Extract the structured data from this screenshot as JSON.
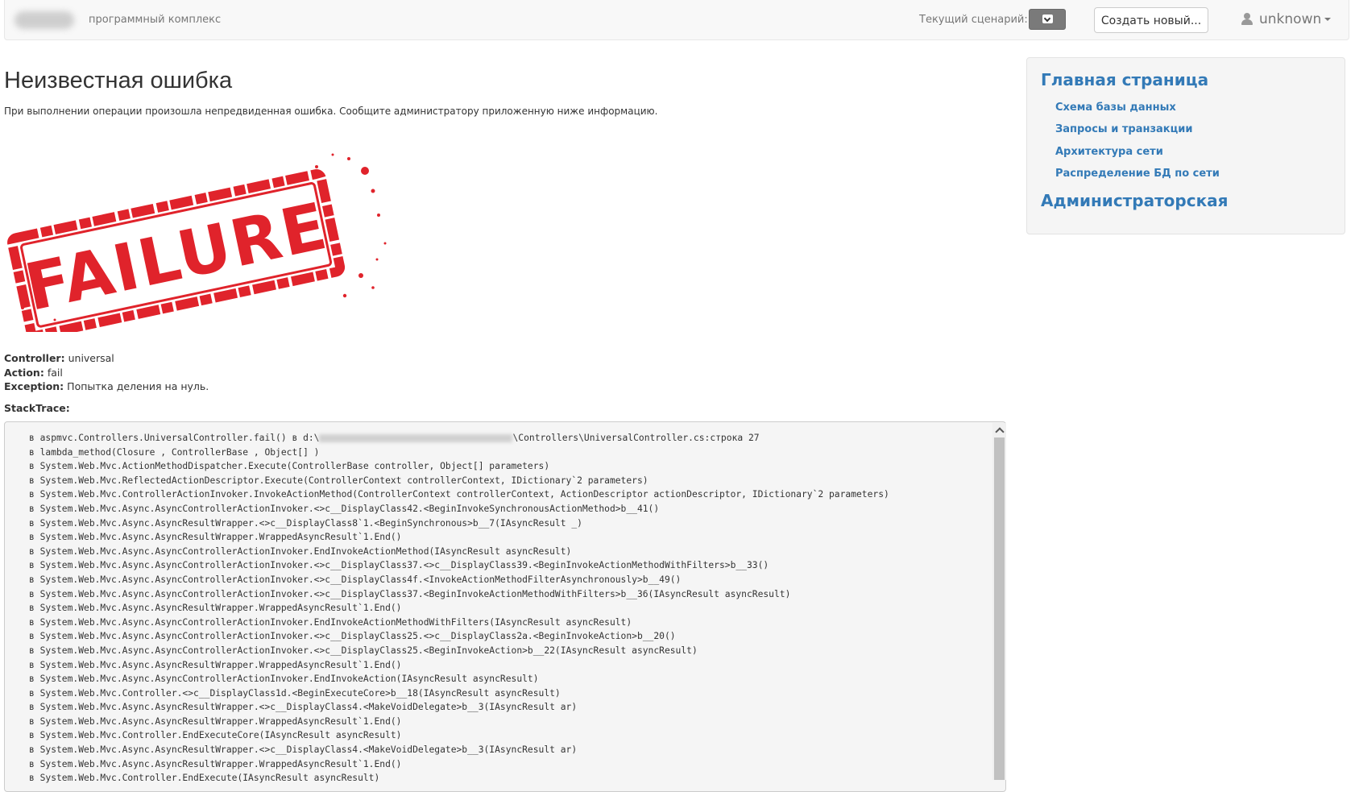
{
  "navbar": {
    "brand_text": "программный комплекс",
    "scenario_label": "Текущий сценарий:",
    "create_button": "Создать новый...",
    "user_name": "unknown"
  },
  "main": {
    "title": "Неизвестная ошибка",
    "subtitle": "При выполнении операции произошла непредвиденная ошибка. Сообщите администратору приложенную ниже информацию.",
    "image_text": "FAILURE",
    "controller_label": "Controller:",
    "controller_value": "universal",
    "action_label": "Action:",
    "action_value": "fail",
    "exception_label": "Exception:",
    "exception_value": "Попытка деления на нуль.",
    "stacktrace_label": "StackTrace:",
    "stack_first_prefix": "в aspmvc.Controllers.UniversalController.fail() в d:\\",
    "stack_first_suffix": "\\Controllers\\UniversalController.cs:строка 27",
    "stack_lines": [
      "в lambda_method(Closure , ControllerBase , Object[] )",
      "в System.Web.Mvc.ActionMethodDispatcher.Execute(ControllerBase controller, Object[] parameters)",
      "в System.Web.Mvc.ReflectedActionDescriptor.Execute(ControllerContext controllerContext, IDictionary`2 parameters)",
      "в System.Web.Mvc.ControllerActionInvoker.InvokeActionMethod(ControllerContext controllerContext, ActionDescriptor actionDescriptor, IDictionary`2 parameters)",
      "в System.Web.Mvc.Async.AsyncControllerActionInvoker.<>c__DisplayClass42.<BeginInvokeSynchronousActionMethod>b__41()",
      "в System.Web.Mvc.Async.AsyncResultWrapper.<>c__DisplayClass8`1.<BeginSynchronous>b__7(IAsyncResult _)",
      "в System.Web.Mvc.Async.AsyncResultWrapper.WrappedAsyncResult`1.End()",
      "в System.Web.Mvc.Async.AsyncControllerActionInvoker.EndInvokeActionMethod(IAsyncResult asyncResult)",
      "в System.Web.Mvc.Async.AsyncControllerActionInvoker.<>c__DisplayClass37.<>c__DisplayClass39.<BeginInvokeActionMethodWithFilters>b__33()",
      "в System.Web.Mvc.Async.AsyncControllerActionInvoker.<>c__DisplayClass4f.<InvokeActionMethodFilterAsynchronously>b__49()",
      "в System.Web.Mvc.Async.AsyncControllerActionInvoker.<>c__DisplayClass37.<BeginInvokeActionMethodWithFilters>b__36(IAsyncResult asyncResult)",
      "в System.Web.Mvc.Async.AsyncResultWrapper.WrappedAsyncResult`1.End()",
      "в System.Web.Mvc.Async.AsyncControllerActionInvoker.EndInvokeActionMethodWithFilters(IAsyncResult asyncResult)",
      "в System.Web.Mvc.Async.AsyncControllerActionInvoker.<>c__DisplayClass25.<>c__DisplayClass2a.<BeginInvokeAction>b__20()",
      "в System.Web.Mvc.Async.AsyncControllerActionInvoker.<>c__DisplayClass25.<BeginInvokeAction>b__22(IAsyncResult asyncResult)",
      "в System.Web.Mvc.Async.AsyncResultWrapper.WrappedAsyncResult`1.End()",
      "в System.Web.Mvc.Async.AsyncControllerActionInvoker.EndInvokeAction(IAsyncResult asyncResult)",
      "в System.Web.Mvc.Controller.<>c__DisplayClass1d.<BeginExecuteCore>b__18(IAsyncResult asyncResult)",
      "в System.Web.Mvc.Async.AsyncResultWrapper.<>c__DisplayClass4.<MakeVoidDelegate>b__3(IAsyncResult ar)",
      "в System.Web.Mvc.Async.AsyncResultWrapper.WrappedAsyncResult`1.End()",
      "в System.Web.Mvc.Controller.EndExecuteCore(IAsyncResult asyncResult)",
      "в System.Web.Mvc.Async.AsyncResultWrapper.<>c__DisplayClass4.<MakeVoidDelegate>b__3(IAsyncResult ar)",
      "в System.Web.Mvc.Async.AsyncResultWrapper.WrappedAsyncResult`1.End()",
      "в System.Web.Mvc.Controller.EndExecute(IAsyncResult asyncResult)"
    ]
  },
  "sidebar": {
    "main_page": "Главная страница",
    "items": [
      "Схема базы данных",
      "Запросы и транзакции",
      "Архитектура сети",
      "Распределение БД по сети"
    ],
    "admin": "Администраторская"
  },
  "colors": {
    "link": "#337ab7",
    "failure_red": "#e0232b"
  }
}
